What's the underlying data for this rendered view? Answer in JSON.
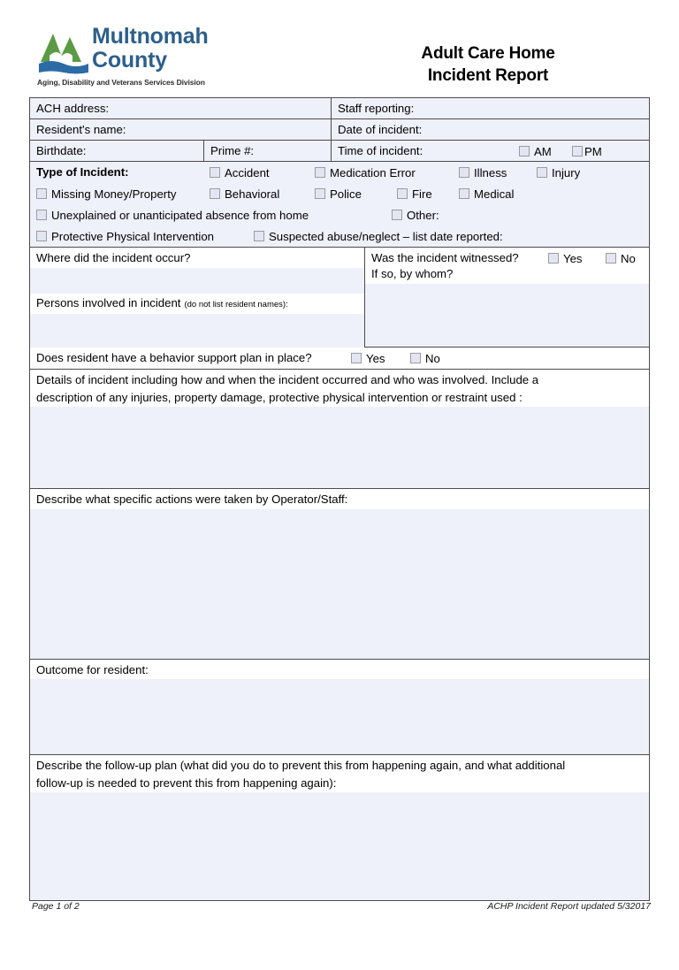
{
  "header": {
    "logo_line1": "Multnomah",
    "logo_line2": "County",
    "tagline": "Aging, Disability and Veterans Services Division",
    "title_line1": "Adult Care Home",
    "title_line2": "Incident Report",
    "logo_green": "#5b9b45",
    "logo_blue": "#2d6ba6",
    "wordmark_color": "#2d5f8b"
  },
  "colors": {
    "field_shade": "#eef0fa",
    "border": "#4c4c4c",
    "checkbox_fill": "#e3e6f2",
    "checkbox_border": "#9c9c9c"
  },
  "fields": {
    "ach_address": "ACH address:",
    "staff_reporting": "Staff reporting:",
    "resident_name": "Resident's name:",
    "date_of_incident": "Date of incident:",
    "birthdate": "Birthdate:",
    "prime_number": "Prime #:",
    "time_of_incident": "Time of incident:",
    "am": "AM",
    "pm": "PM"
  },
  "incident_type": {
    "label": "Type of Incident:",
    "row1": [
      "Accident",
      "Medication Error",
      "Illness",
      "Injury"
    ],
    "row2": [
      "Missing Money/Property",
      "Behavioral",
      "Police",
      "Fire",
      "Medical"
    ],
    "row3": [
      "Unexplained or unanticipated absence from home",
      "Other:"
    ],
    "row4": [
      "Protective Physical Intervention",
      "Suspected abuse/neglect – list date reported:"
    ]
  },
  "where": {
    "question": "Where did the incident occur?",
    "persons_label": "Persons involved in incident",
    "persons_note": "(do not list resident names):",
    "witnessed_question": "Was the incident witnessed?",
    "witnessed_yes": "Yes",
    "witnessed_no": "No",
    "by_whom": "If so, by whom?"
  },
  "behavior_plan": {
    "question": "Does resident have a behavior support plan in place?",
    "yes": "Yes",
    "no": "No"
  },
  "sections": {
    "details_line1": "Details of incident including how and when the incident occurred and who was involved. Include a",
    "details_line2": "description of any injuries, property damage, protective physical intervention or restraint used :",
    "actions": "Describe what specific actions were taken by Operator/Staff:",
    "outcome": "Outcome for resident:",
    "followup_line1": "Describe the follow-up plan (what did you do to prevent this from happening again, and what additional",
    "followup_line2": "follow-up is needed to prevent this from happening again):"
  },
  "footer": {
    "page": "Page 1 of 2",
    "revision": "ACHP Incident Report updated 5/32017"
  }
}
